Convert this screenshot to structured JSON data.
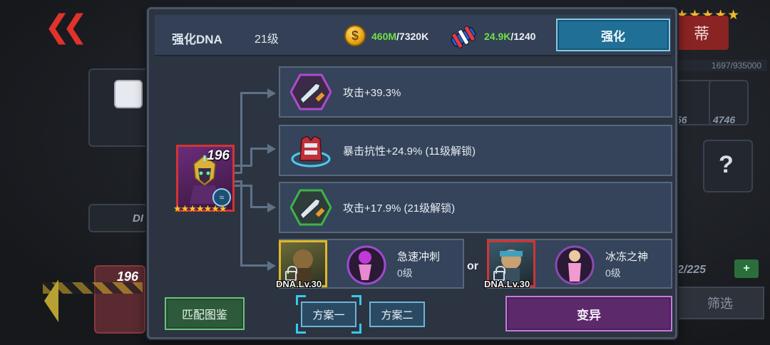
{
  "background": {
    "red_tab_label": "蒂",
    "progress_text": "1697/935000",
    "count_a": "56",
    "count_b": "4746",
    "count_c": "2/225",
    "hero_level": "196",
    "filter_label": "筛选",
    "side_label": "DI"
  },
  "header": {
    "title": "强化DNA",
    "level": "21级",
    "coin_current": "460M",
    "coin_total": "/7320K",
    "dna_current": "24.9K",
    "dna_total": "/1240",
    "enhance_label": "强化"
  },
  "hero": {
    "level": "196",
    "stars": "★★★★★★★"
  },
  "attributes": [
    {
      "icon": "sword-icon",
      "text": "攻击+39.3%"
    },
    {
      "icon": "armor-icon",
      "text": "暴击抗性+24.9%  (11级解锁)"
    },
    {
      "icon": "sword-icon",
      "text": "攻击+17.9%  (21级解锁)"
    }
  ],
  "options": {
    "left": {
      "dna_label": "DNA.Lv.30",
      "skill_name": "急速冲刺",
      "skill_level": "0级"
    },
    "or_label": "or",
    "right": {
      "dna_label": "DNA.Lv.30",
      "skill_name": "冰冻之神",
      "skill_level": "0级"
    }
  },
  "buttons": {
    "match_label": "匹配图鉴",
    "plan1_label": "方案一",
    "plan2_label": "方案二",
    "mutate_label": "变异"
  },
  "colors": {
    "accent_blue": "#1f6f96",
    "resource_green": "#6fe04a",
    "mutate_purple": "#5c2a6b",
    "hero_frame_red": "#d23434"
  }
}
